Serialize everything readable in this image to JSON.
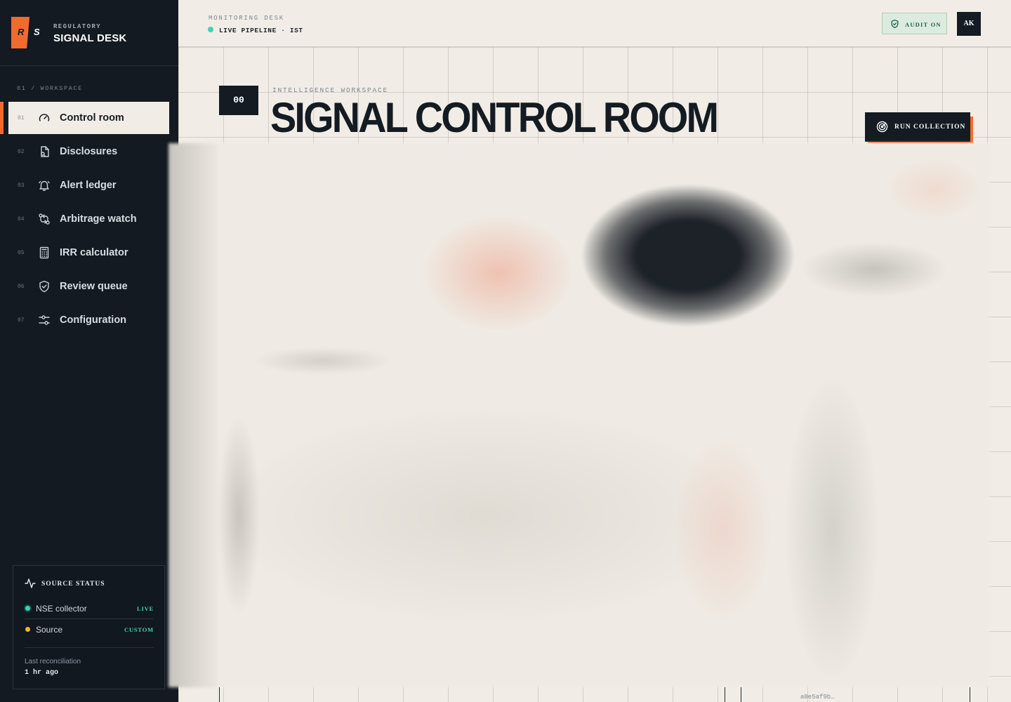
{
  "brand": {
    "logo_left": "R",
    "logo_right": "S",
    "eyebrow": "REGULATORY",
    "name": "SIGNAL DESK"
  },
  "sidebar": {
    "section_label": "01 / WORKSPACE",
    "items": [
      {
        "num": "01",
        "label": "Control room",
        "icon": "gauge-icon",
        "active": true
      },
      {
        "num": "02",
        "label": "Disclosures",
        "icon": "document-search-icon",
        "active": false
      },
      {
        "num": "03",
        "label": "Alert ledger",
        "icon": "bell-icon",
        "active": false
      },
      {
        "num": "04",
        "label": "Arbitrage watch",
        "icon": "swap-routes-icon",
        "active": false
      },
      {
        "num": "05",
        "label": "IRR calculator",
        "icon": "calculator-icon",
        "active": false
      },
      {
        "num": "06",
        "label": "Review queue",
        "icon": "shield-check-icon",
        "active": false
      },
      {
        "num": "07",
        "label": "Configuration",
        "icon": "sliders-icon",
        "active": false
      }
    ],
    "source_status": {
      "title": "SOURCE STATUS",
      "icon": "activity-icon",
      "rows": [
        {
          "name": "NSE collector",
          "tag": "LIVE",
          "dot_color": "#3fd3b5"
        },
        {
          "name": "Source",
          "tag": "CUSTOM",
          "dot_color": "#f2b43a"
        }
      ],
      "recon_label": "Last reconciliation",
      "recon_value": "1 hr ago"
    }
  },
  "topbar": {
    "desk_label": "MONITORING DESK",
    "pipeline": "LIVE PIPELINE · IST",
    "audit_label": "AUDIT ON",
    "avatar": "AK"
  },
  "hero": {
    "section_num": "00",
    "kicker": "INTELLIGENCE WORKSPACE",
    "title": "SIGNAL CONTROL ROOM",
    "run_button": "RUN COLLECTION"
  },
  "footer": {
    "hash": "a0e5af9b…"
  },
  "colors": {
    "accent": "#f26a2e",
    "sidebar_bg": "#131a21",
    "page_bg": "#f1ede6",
    "live": "#3fd3b5",
    "custom": "#f2b43a"
  }
}
